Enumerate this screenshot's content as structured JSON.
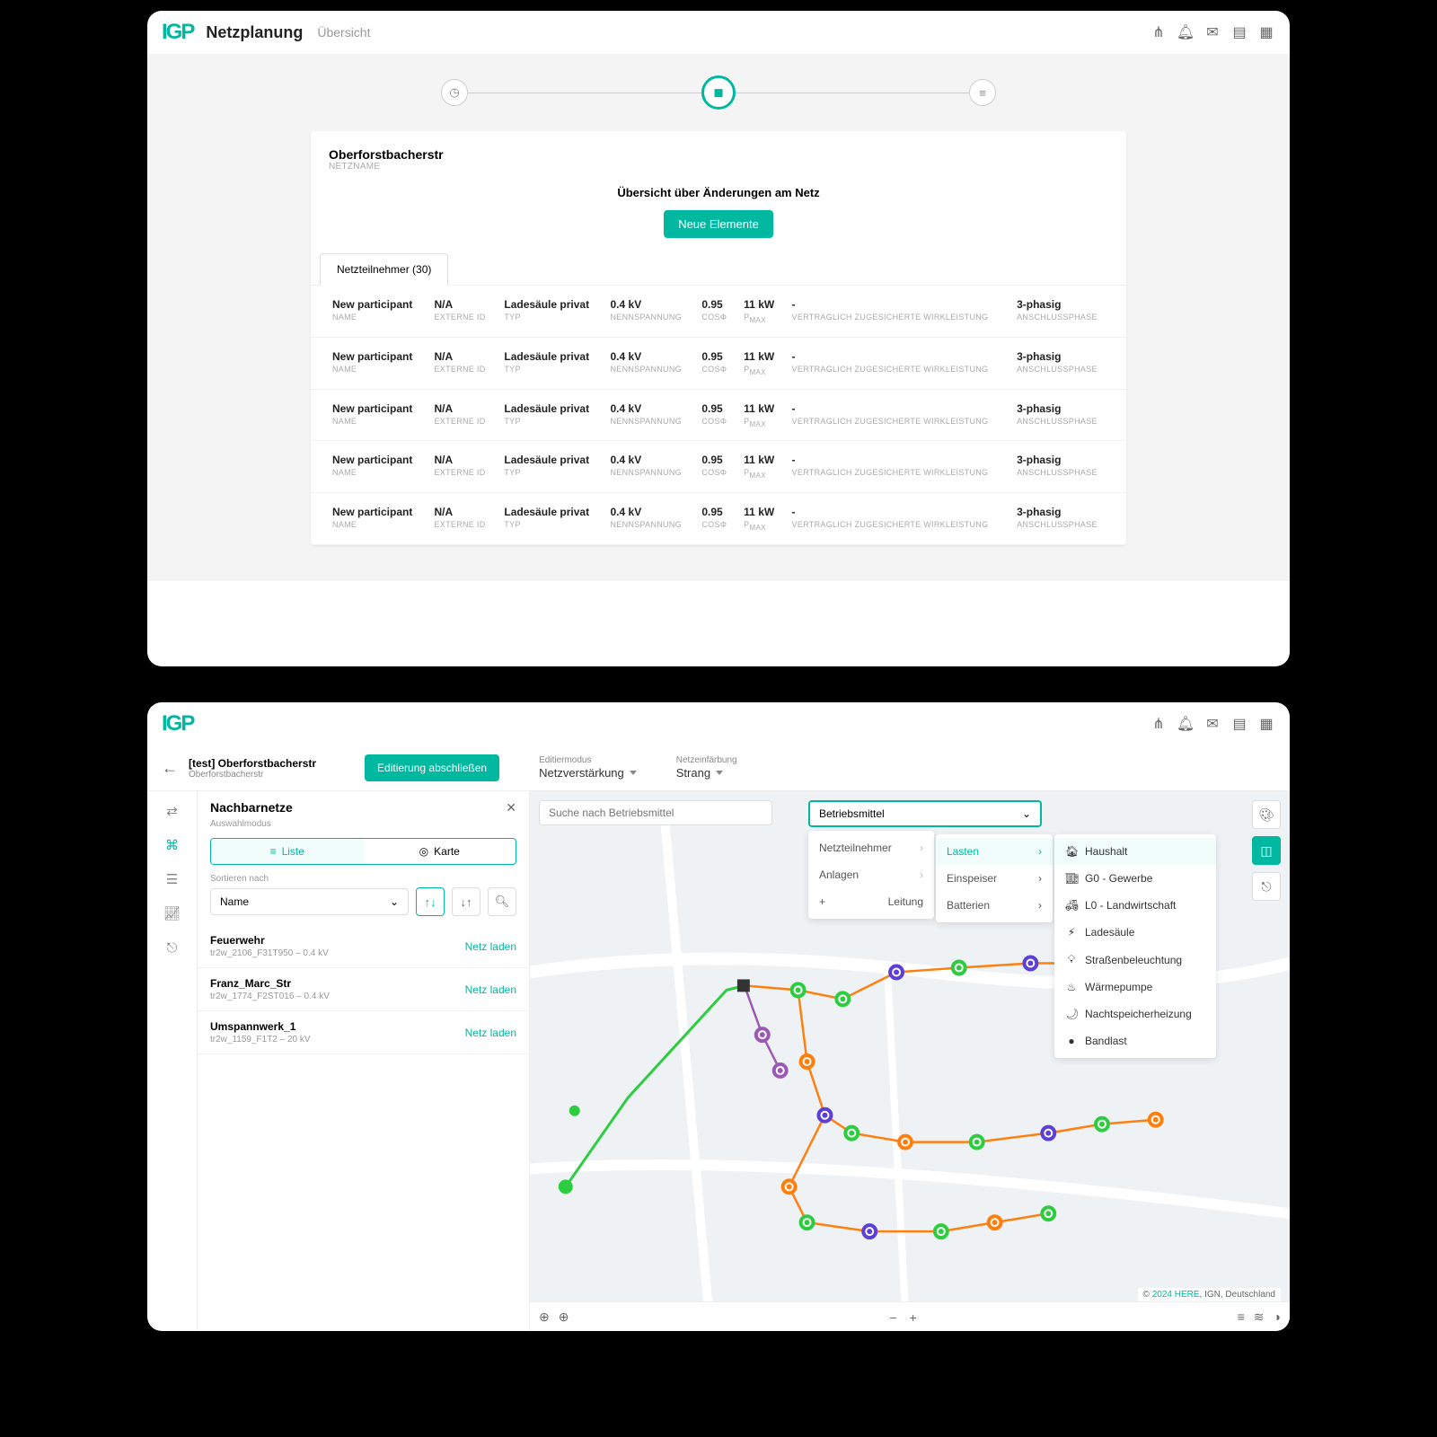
{
  "brand": "IGP",
  "w1": {
    "app_title": "Netzplanung",
    "subtitle": "Übersicht",
    "netname": "Oberforstbacherstr",
    "netname_label": "NETZNAME",
    "changes_title": "Übersicht über Änderungen am Netz",
    "new_elements": "Neue Elemente",
    "tab": "Netzteilnehmer (30)",
    "columns": {
      "name": "NAME",
      "externe_id": "EXTERNE ID",
      "typ": "TYP",
      "nennspannung": "NENNSPANNUNG",
      "cosphi": "COSΦ",
      "pmax": "P",
      "pmax_sub": "MAX",
      "wirkleistung": "VERTRAGLICH ZUGESICHERTE WIRKLEISTUNG",
      "anschluss": "ANSCHLUSSPHASE"
    },
    "rows": [
      {
        "name": "New participant",
        "ext": "N/A",
        "typ": "Ladesäule privat",
        "kv": "0.4 kV",
        "cos": "0.95",
        "pmax": "11 kW",
        "wirk": "-",
        "phase": "3-phasig"
      },
      {
        "name": "New participant",
        "ext": "N/A",
        "typ": "Ladesäule privat",
        "kv": "0.4 kV",
        "cos": "0.95",
        "pmax": "11 kW",
        "wirk": "-",
        "phase": "3-phasig"
      },
      {
        "name": "New participant",
        "ext": "N/A",
        "typ": "Ladesäule privat",
        "kv": "0.4 kV",
        "cos": "0.95",
        "pmax": "11 kW",
        "wirk": "-",
        "phase": "3-phasig"
      },
      {
        "name": "New participant",
        "ext": "N/A",
        "typ": "Ladesäule privat",
        "kv": "0.4 kV",
        "cos": "0.95",
        "pmax": "11 kW",
        "wirk": "-",
        "phase": "3-phasig"
      },
      {
        "name": "New participant",
        "ext": "N/A",
        "typ": "Ladesäule privat",
        "kv": "0.4 kV",
        "cos": "0.95",
        "pmax": "11 kW",
        "wirk": "-",
        "phase": "3-phasig"
      }
    ]
  },
  "w2": {
    "context_title": "[test] Oberforstbacherstr",
    "context_sub": "Oberforstbacherstr",
    "finish_edit": "Editierung abschließen",
    "edit_mode_label": "Editiermodus",
    "edit_mode_value": "Netzverstärkung",
    "net_color_label": "Netzeinfärbung",
    "net_color_value": "Strang",
    "panel": {
      "title": "Nachbarnetze",
      "hint": "Auswahlmodus",
      "seg_list": "Liste",
      "seg_map": "Karte",
      "sort_label": "Sortieren nach",
      "sort_value": "Name",
      "items": [
        {
          "name": "Feuerwehr",
          "sub": "tr2w_2106_F31T950 – 0.4 kV",
          "action": "Netz laden"
        },
        {
          "name": "Franz_Marc_Str",
          "sub": "tr2w_1774_F2ST016 – 0.4 kV",
          "action": "Netz laden"
        },
        {
          "name": "Umspannwerk_1",
          "sub": "tr2w_1159_F1T2 – 20 kV",
          "action": "Netz laden"
        }
      ]
    },
    "search_placeholder": "Suche nach Betriebsmittel",
    "dropdown_label": "Betriebsmittel",
    "menu_level1": [
      "Netzteilnehmer",
      "Anlagen",
      "Leitung"
    ],
    "menu_level2": [
      "Lasten",
      "Einspeiser",
      "Batterien"
    ],
    "menu_level3": [
      "Haushalt",
      "G0 - Gewerbe",
      "L0 - Landwirtschaft",
      "Ladesäule",
      "Straßenbeleuchtung",
      "Wärmepumpe",
      "Nachtspeicherheizung",
      "Bandlast"
    ],
    "attribution": {
      "copy": "©",
      "year": "2024 HERE",
      "suffix": ", IGN, Deutschland"
    }
  }
}
